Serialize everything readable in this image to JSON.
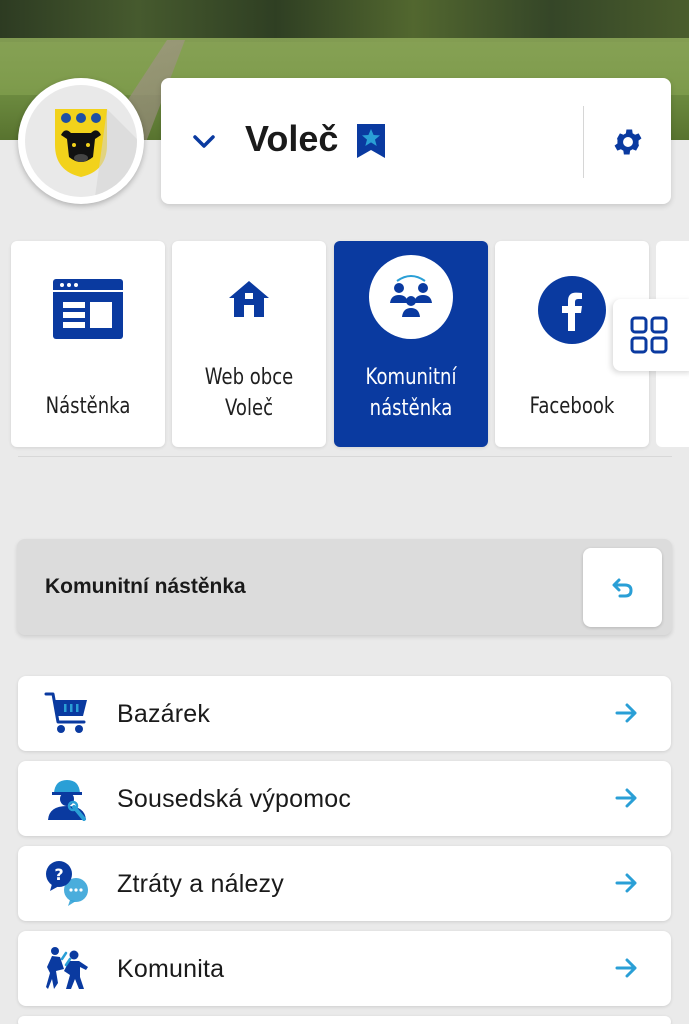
{
  "header": {
    "title": "Voleč",
    "colors": {
      "brand": "#0a3aa0",
      "accent": "#2a9fd6",
      "star": "#2a9fd6"
    }
  },
  "tiles": [
    {
      "label_line1": "Nástěnka",
      "label_line2": "",
      "icon": "bulletin-board-icon",
      "active": false
    },
    {
      "label_line1": "Web obce",
      "label_line2": "Voleč",
      "icon": "home-icon",
      "active": false
    },
    {
      "label_line1": "Komunitní",
      "label_line2": "nástěnka",
      "icon": "community-icon",
      "active": true
    },
    {
      "label_line1": "Facebook",
      "label_line2": "",
      "icon": "facebook-icon",
      "active": false
    }
  ],
  "section": {
    "title": "Komunitní nástěnka"
  },
  "list": [
    {
      "label": "Bazárek",
      "icon": "cart-icon"
    },
    {
      "label": "Sousedská výpomoc",
      "icon": "worker-icon"
    },
    {
      "label": "Ztráty a nálezy",
      "icon": "question-chat-icon"
    },
    {
      "label": "Komunita",
      "icon": "people-running-icon"
    }
  ]
}
